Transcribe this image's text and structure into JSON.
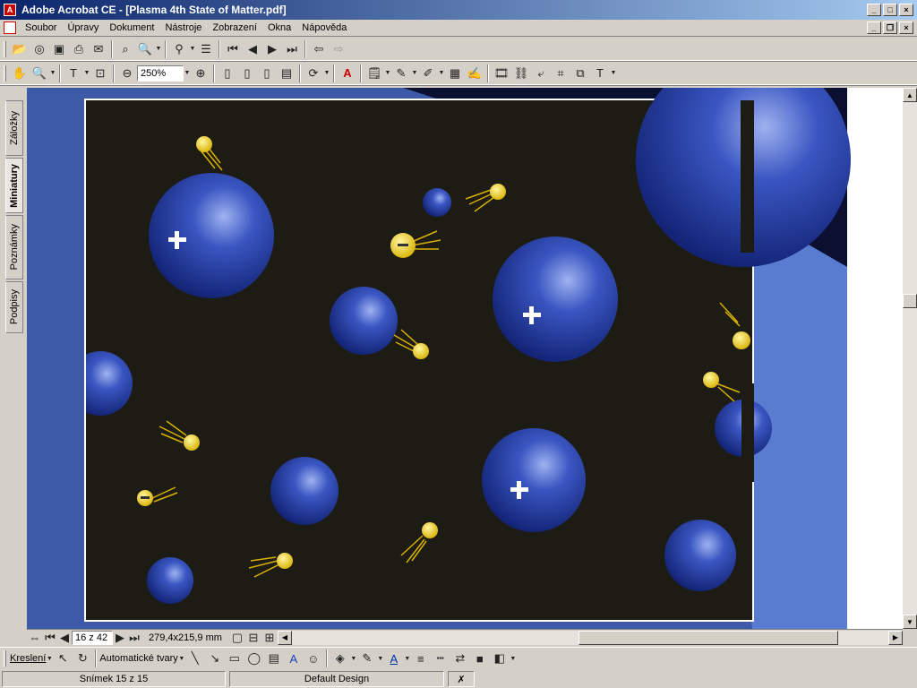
{
  "window": {
    "title": "Adobe Acrobat CE - [Plasma 4th State of Matter.pdf]"
  },
  "menu": [
    "Soubor",
    "Úpravy",
    "Dokument",
    "Nástroje",
    "Zobrazení",
    "Okna",
    "Nápověda"
  ],
  "toolbar": {
    "zoom_value": "250%"
  },
  "sidebar_tabs": [
    "Záložky",
    "Miniatury",
    "Poznámky",
    "Podpisy"
  ],
  "navigation": {
    "page_field": "16 z 42",
    "page_size": "279,4x215,9 mm"
  },
  "drawing": {
    "draw_label": "Kreslení",
    "autoshapes_label": "Automatické tvary"
  },
  "status": {
    "slide": "Snímek 15 z 15",
    "design": "Default Design"
  },
  "colors": {
    "title_start": "#0a246a",
    "title_end": "#a6caf0",
    "viewport_bg": "#3d5aa8",
    "slide_bg": "#1d1c14",
    "sphere": "#2a44a8",
    "electron": "#f0d020"
  }
}
